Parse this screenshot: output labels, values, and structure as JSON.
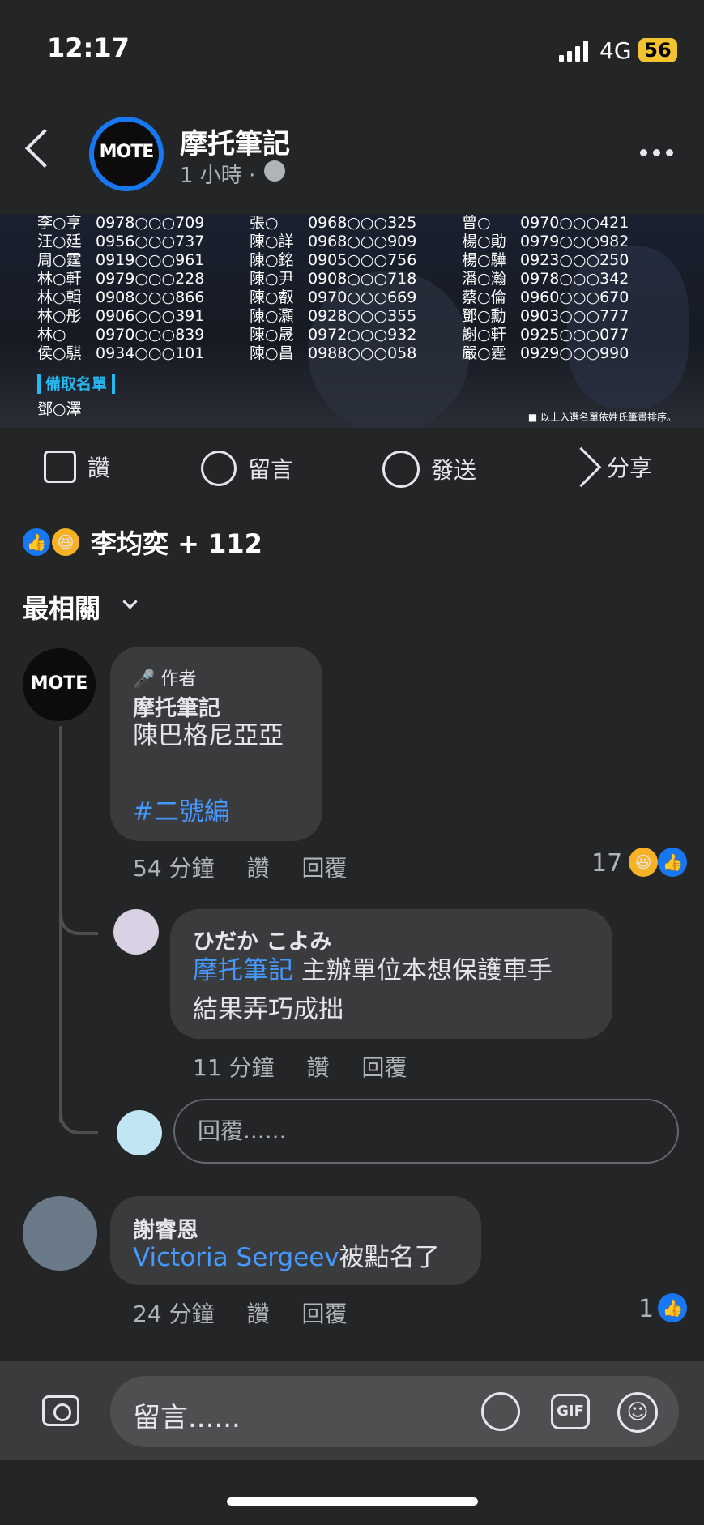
{
  "status": {
    "time": "12:17",
    "network": "4G",
    "battery": "56"
  },
  "header": {
    "page_name": "摩托筆記",
    "posted": "1 小時 ·"
  },
  "banner": {
    "columns": [
      [
        [
          "李○亨",
          "0978○○○709"
        ],
        [
          "汪○廷",
          "0956○○○737"
        ],
        [
          "周○霆",
          "0919○○○961"
        ],
        [
          "林○軒",
          "0979○○○228"
        ],
        [
          "林○輯",
          "0908○○○866"
        ],
        [
          "林○彤",
          "0906○○○391"
        ],
        [
          "林○",
          "0970○○○839"
        ],
        [
          "侯○騏",
          "0934○○○101"
        ]
      ],
      [
        [
          "張○",
          "0968○○○325"
        ],
        [
          "陳○詳",
          "0968○○○909"
        ],
        [
          "陳○銘",
          "0905○○○756"
        ],
        [
          "陳○尹",
          "0908○○○718"
        ],
        [
          "陳○叡",
          "0970○○○669"
        ],
        [
          "陳○灝",
          "0928○○○355"
        ],
        [
          "陳○晟",
          "0972○○○932"
        ],
        [
          "陳○昌",
          "0988○○○058"
        ]
      ],
      [
        [
          "曾○",
          "0970○○○421"
        ],
        [
          "楊○勛",
          "0979○○○982"
        ],
        [
          "楊○驊",
          "0923○○○250"
        ],
        [
          "潘○瀚",
          "0978○○○342"
        ],
        [
          "蔡○倫",
          "0960○○○670"
        ],
        [
          "鄧○勳",
          "0903○○○777"
        ],
        [
          "謝○軒",
          "0925○○○077"
        ],
        [
          "嚴○霆",
          "0929○○○990"
        ]
      ]
    ],
    "backup_label": "備取名單",
    "backup_name": "鄧○澤",
    "note": "■ 以上入選名單依姓氏筆畫排序。"
  },
  "actions": {
    "like": "讚",
    "comment": "留言",
    "send": "發送",
    "share": "分享"
  },
  "reactions": {
    "summary": "李均奕 + 112"
  },
  "sort": {
    "label": "最相關"
  },
  "comments": [
    {
      "author_badge": "作者",
      "name": "摩托筆記",
      "text": "陳巴格尼亞亞",
      "hashtag": "#二號編",
      "time": "54 分鐘",
      "like": "讚",
      "reply": "回覆",
      "reaction_count": "17",
      "replies": [
        {
          "name": "ひだか こよみ",
          "mention": "摩托筆記",
          "text_line1": " 主辦單位本想保護車手",
          "text_line2": "結果弄巧成拙",
          "time": "11 分鐘",
          "like": "讚",
          "reply": "回覆"
        }
      ],
      "reply_placeholder": "回覆......"
    },
    {
      "name": "謝睿恩",
      "mention": "Victoria Sergeev",
      "text": "被點名了",
      "time": "24 分鐘",
      "like": "讚",
      "reply": "回覆",
      "reaction_count": "1"
    }
  ],
  "composer": {
    "placeholder": "留言......",
    "gif": "GIF"
  },
  "logo_text": "MOTE",
  "colors": {
    "background": "#242527",
    "bubble": "#3a3b3c",
    "link": "#4599ff",
    "like_blue": "#1877f2"
  }
}
